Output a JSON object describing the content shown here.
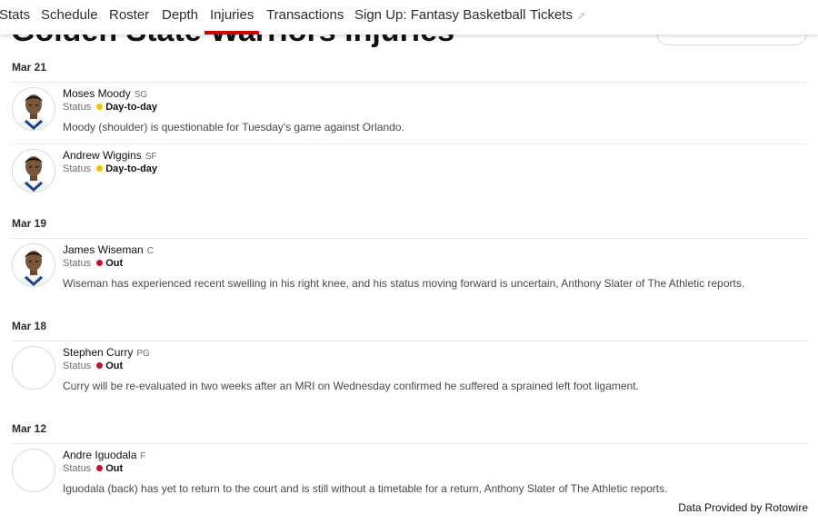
{
  "page_title": "Golden State Warriors Injuries",
  "nav": {
    "tabs": [
      {
        "label": "Stats",
        "active": false
      },
      {
        "label": "Schedule",
        "active": false
      },
      {
        "label": "Roster",
        "active": false
      },
      {
        "label": "Depth",
        "active": false
      },
      {
        "label": "Injuries",
        "active": true
      },
      {
        "label": "Transactions",
        "active": false
      },
      {
        "label": "Sign Up: Fantasy Basketball",
        "active": false
      },
      {
        "label": "Tickets",
        "active": false,
        "icon": "external-link-icon"
      }
    ],
    "active_color": "#d00000"
  },
  "status_label": "Status",
  "status_colors": {
    "day_to_day": "#f2c100",
    "out": "#c8102e"
  },
  "groups": [
    {
      "date": "Mar 21",
      "players": [
        {
          "name": "Moses Moody",
          "position": "SG",
          "status": "Day-to-day",
          "status_key": "day_to_day",
          "note": "Moody (shoulder) is questionable for Tuesday's game against Orlando.",
          "has_photo": true
        },
        {
          "name": "Andrew Wiggins",
          "position": "SF",
          "status": "Day-to-day",
          "status_key": "day_to_day",
          "note": "",
          "has_photo": true
        }
      ]
    },
    {
      "date": "Mar 19",
      "players": [
        {
          "name": "James Wiseman",
          "position": "C",
          "status": "Out",
          "status_key": "out",
          "note": "Wiseman has experienced recent swelling in his right knee, and his status moving forward is uncertain, Anthony Slater of The Athletic reports.",
          "has_photo": true
        }
      ]
    },
    {
      "date": "Mar 18",
      "players": [
        {
          "name": "Stephen Curry",
          "position": "PG",
          "status": "Out",
          "status_key": "out",
          "note": "Curry will be re-evaluated in two weeks after an MRI on Wednesday confirmed he suffered a sprained left foot ligament.",
          "has_photo": false
        }
      ]
    },
    {
      "date": "Mar 12",
      "players": [
        {
          "name": "Andre Iguodala",
          "position": "F",
          "status": "Out",
          "status_key": "out",
          "note": "Iguodala (back) has yet to return to the court and is still without a timetable for a return, Anthony Slater of The Athletic reports.",
          "has_photo": false
        }
      ]
    }
  ],
  "footer": "Data Provided by Rotowire"
}
